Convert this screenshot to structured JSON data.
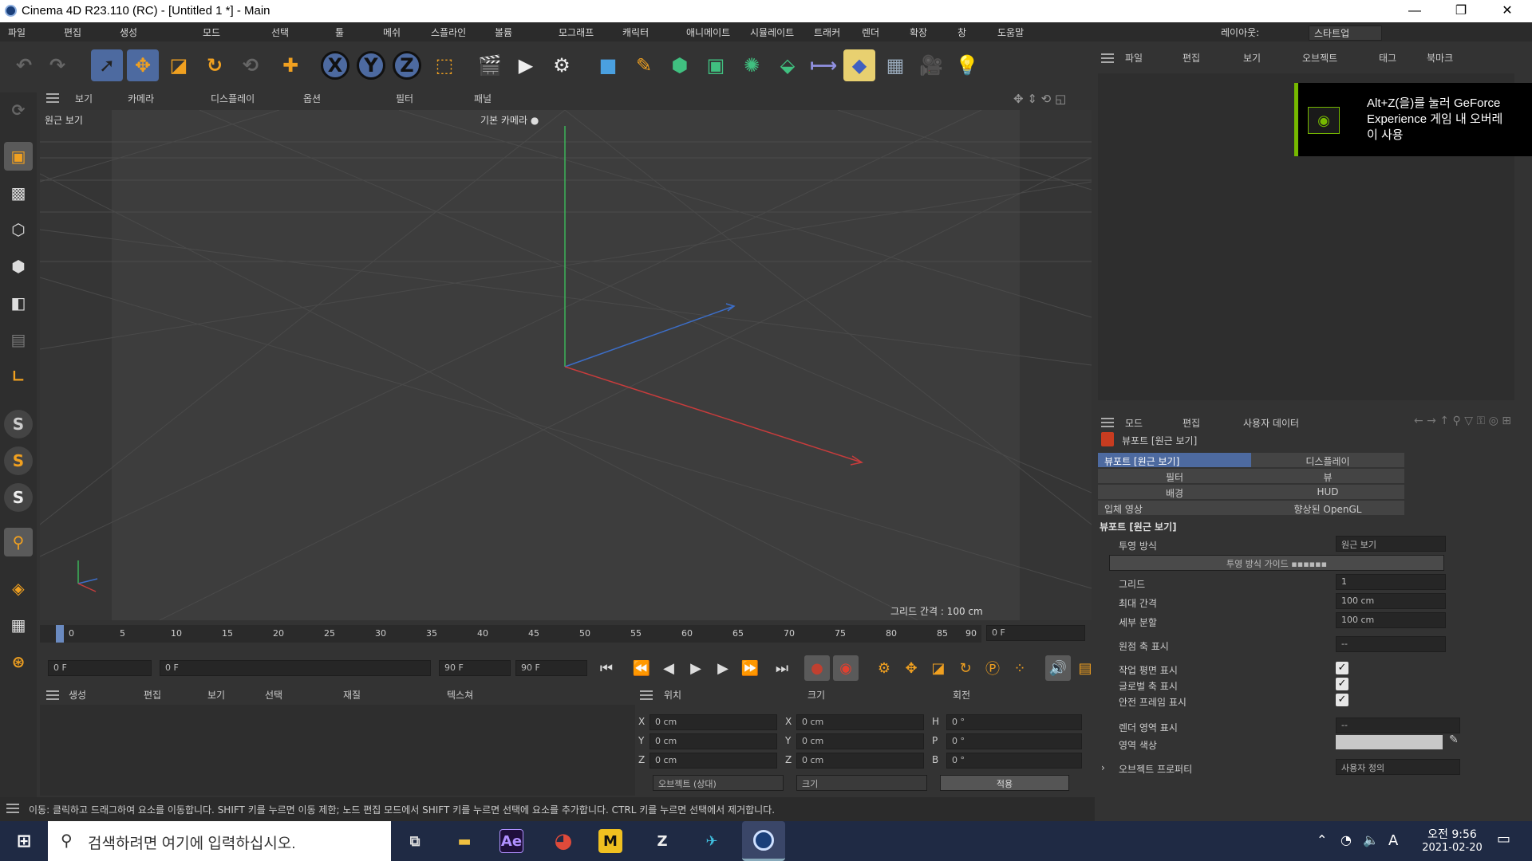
{
  "window": {
    "title": "Cinema 4D R23.110 (RC) - [Untitled 1 *] - Main",
    "minimize": "—",
    "maximize": "❐",
    "close": "✕"
  },
  "menubar": {
    "items": [
      "파일",
      "편집",
      "생성",
      "모드",
      "선택",
      "툴",
      "메쉬",
      "스플라인",
      "볼륨",
      "모그래프",
      "캐릭터",
      "애니메이트",
      "시뮬레이트",
      "트래커",
      "렌더",
      "확장",
      "창",
      "도움말"
    ],
    "layout_label": "레이아웃:",
    "layout_value": "스타트업"
  },
  "toolbar": {
    "undo_icon": "undo-icon",
    "redo_icon": "redo-icon",
    "x_label": "X",
    "y_label": "Y",
    "z_label": "Z"
  },
  "viewport": {
    "menu": [
      "보기",
      "카메라",
      "디스플레이",
      "옵션",
      "필터",
      "패널"
    ],
    "label_top_left": "원근 보기",
    "label_top_center": "기본 카메라 ●",
    "grid_spacing": "그리드 간격 : 100 cm"
  },
  "timeline": {
    "ticks": [
      "0",
      "5",
      "10",
      "15",
      "20",
      "25",
      "30",
      "35",
      "40",
      "45",
      "50",
      "55",
      "60",
      "65",
      "70",
      "75",
      "80",
      "85",
      "90"
    ],
    "frame_end": "0 F",
    "start_field": "0 F",
    "start_field2": "0 F",
    "end_field": "90 F",
    "end_field2": "90 F"
  },
  "lower_panel": {
    "menu": [
      "생성",
      "편집",
      "보기",
      "선택",
      "재질",
      "텍스쳐"
    ],
    "coords_header": [
      "위치",
      "크기",
      "회전"
    ],
    "coords_rows": [
      [
        "X",
        "0 cm",
        "X",
        "0 cm",
        "H",
        "0 °"
      ],
      [
        "Y",
        "0 cm",
        "Y",
        "0 cm",
        "P",
        "0 °"
      ],
      [
        "Z",
        "0 cm",
        "Z",
        "0 cm",
        "B",
        "0 °"
      ]
    ],
    "mode_select": "오브젝트 (상대)",
    "size_select": "크기",
    "apply_button": "적용"
  },
  "statusbar": {
    "text": "이동: 클릭하고 드래그하여 요소를 이동합니다. SHIFT 키를 누르면 이동 제한; 노드 편집 모드에서 SHIFT 키를 누르면 선택에 요소를 추가합니다. CTRL 키를 누르면 선택에서 제거합니다."
  },
  "objects_panel": {
    "menu": [
      "파일",
      "편집",
      "보기",
      "오브젝트",
      "태그",
      "북마크"
    ]
  },
  "attributes_panel": {
    "menu": [
      "모드",
      "편집",
      "사용자 데이터"
    ],
    "title": "뷰포트 [원근 보기]",
    "tabs": [
      [
        "뷰포트 [원근 보기]",
        "디스플레이"
      ],
      [
        "필터",
        "뷰"
      ],
      [
        "배경",
        "HUD"
      ],
      [
        "입체 영상",
        "향상된 OpenGL"
      ]
    ],
    "section": "뷰포트 [원근 보기]",
    "projection_label": "투영 방식",
    "projection_value": "원근 보기",
    "frame_button": "투영 방식 가이드 ▪▪▪▪▪▪",
    "rows": [
      [
        "그리드",
        "1"
      ],
      [
        "최대 간격",
        "100 cm"
      ],
      [
        "세부 분할",
        "100 cm"
      ],
      [
        "원점 축 표시",
        "--"
      ]
    ],
    "checks": [
      [
        "작업 평면 표시",
        "✓"
      ],
      [
        "글로벌 축 표시",
        "✓"
      ],
      [
        "안전 프레임 표시",
        "✓"
      ]
    ],
    "render_label": "렌더 영역 표시",
    "render_value": "--",
    "color_label": "영역 색상",
    "extra_label": "오브젝트 프로퍼티",
    "extra_value": "사용자 정의"
  },
  "toast": {
    "line1": "Alt+Z(을)를 눌러 GeForce",
    "line2": "Experience 게임 내 오버레",
    "line3": "이 사용"
  },
  "taskbar": {
    "search_placeholder": "검색하려면 여기에 입력하십시오.",
    "time": "오전 9:56",
    "date": "2021-02-20",
    "ime": "A"
  },
  "colors": {
    "accent": "#4d6aa0",
    "x_axis": "#c83c3c",
    "y_axis": "#3cb45a",
    "z_axis": "#3c6ec8",
    "nvidia": "#76b900"
  }
}
